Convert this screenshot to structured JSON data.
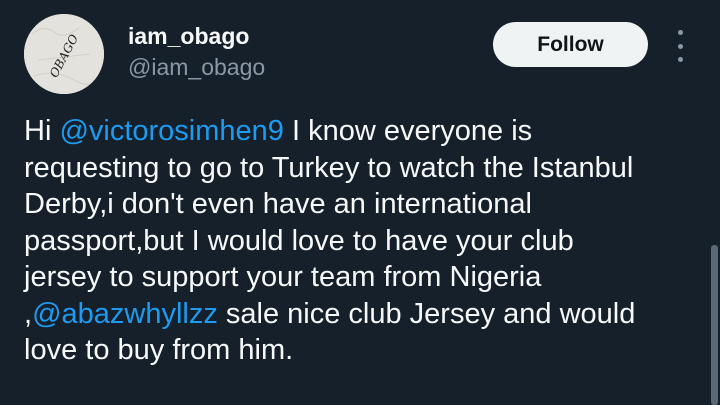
{
  "author": {
    "display_name": "iam_obago",
    "handle": "@iam_obago",
    "avatar_text": "OBAGO"
  },
  "actions": {
    "follow_label": "Follow",
    "more_icon": "more-vertical-icon"
  },
  "tweet": {
    "lines": [
      [
        {
          "text": "Hi "
        },
        {
          "text": "@victorosimhen9",
          "mention": true
        },
        {
          "text": " I know everyone is"
        }
      ],
      [
        {
          "text": "requesting to go to Turkey to watch the Istanbul"
        }
      ],
      [
        {
          "text": "Derby,i don't even have an international"
        }
      ],
      [
        {
          "text": "passport,but I would love to have your club"
        }
      ],
      [
        {
          "text": "jersey to support your team from Nigeria"
        }
      ],
      [
        {
          "text": ","
        },
        {
          "text": "@abazwhyllzz",
          "mention": true
        },
        {
          "text": " sale nice club Jersey and would"
        }
      ],
      [
        {
          "text": "love to buy from him."
        }
      ]
    ]
  },
  "colors": {
    "background": "#15202b",
    "text": "#f7f9f9",
    "secondary_text": "#8b98a5",
    "mention": "#1d9bf0",
    "follow_button_bg": "#eff3f4"
  }
}
